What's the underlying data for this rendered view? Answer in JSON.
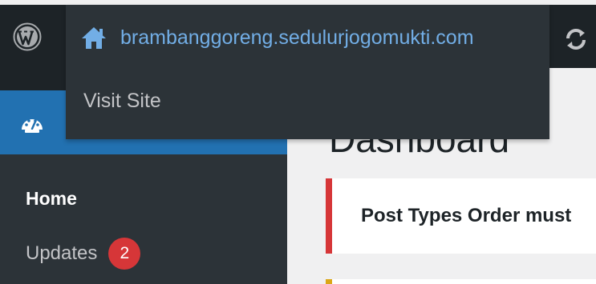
{
  "admin_bar": {
    "site_name": "brambanggoreng.sedulurjogomukti.com",
    "dropdown": {
      "visit_site_label": "Visit Site"
    },
    "icons": [
      "wordpress-icon",
      "home-icon",
      "refresh-icon"
    ]
  },
  "sidebar": {
    "active_item_icon": "dashboard-icon",
    "submenu": {
      "home_label": "Home",
      "updates_label": "Updates",
      "updates_count": "2"
    }
  },
  "main": {
    "page_title": "Dashboard",
    "notice_text": "Post Types Order must"
  },
  "colors": {
    "admin_bar": "#1d2327",
    "dropdown": "#2c3338",
    "accent": "#2271b1",
    "link": "#72aee6",
    "badge": "#d63638"
  }
}
